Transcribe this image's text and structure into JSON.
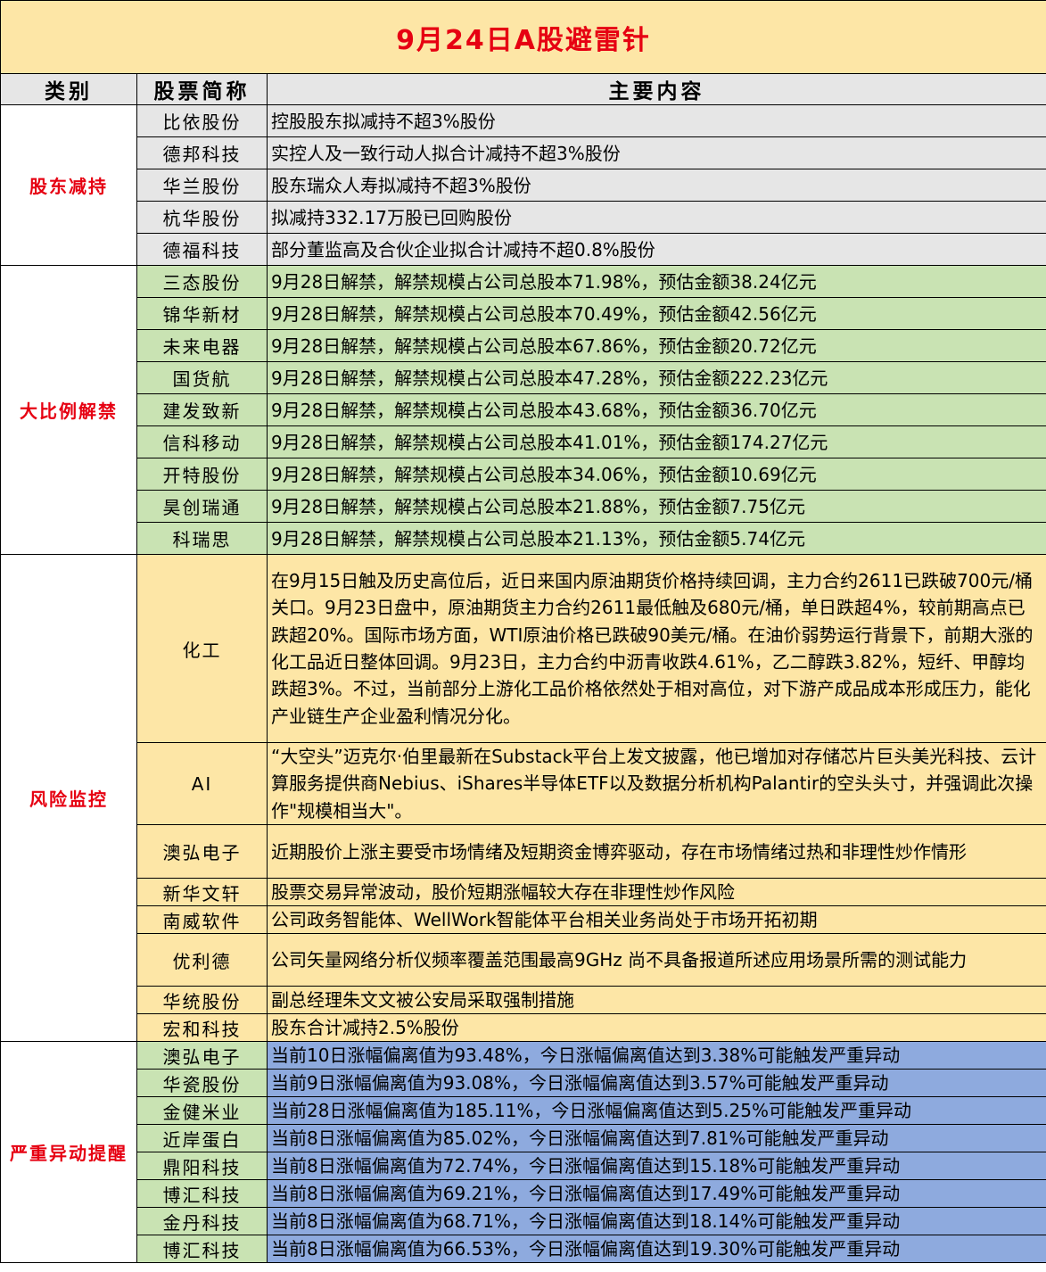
{
  "title": "9月24日A股避雷针",
  "headers": {
    "category": "类别",
    "stock": "股票简称",
    "content": "主要内容"
  },
  "sections": [
    {
      "category": "股东减持",
      "rows": [
        {
          "name": "比依股份",
          "content": "控股股东拟减持不超3%股份"
        },
        {
          "name": "德邦科技",
          "content": "实控人及一致行动人拟合计减持不超3%股份"
        },
        {
          "name": "华兰股份",
          "content": "股东瑞众人寿拟减持不超3%股份"
        },
        {
          "name": "杭华股份",
          "content": "拟减持332.17万股已回购股份"
        },
        {
          "name": "德福科技",
          "content": "部分董监高及合伙企业拟合计减持不超0.8%股份"
        }
      ]
    },
    {
      "category": "大比例解禁",
      "rows": [
        {
          "name": "三态股份",
          "content": "9月28日解禁，解禁规模占公司总股本71.98%，预估金额38.24亿元"
        },
        {
          "name": "锦华新材",
          "content": "9月28日解禁，解禁规模占公司总股本70.49%，预估金额42.56亿元"
        },
        {
          "name": "未来电器",
          "content": "9月28日解禁，解禁规模占公司总股本67.86%，预估金额20.72亿元"
        },
        {
          "name": "国货航",
          "content": "9月28日解禁，解禁规模占公司总股本47.28%，预估金额222.23亿元"
        },
        {
          "name": "建发致新",
          "content": "9月28日解禁，解禁规模占公司总股本43.68%，预估金额36.70亿元"
        },
        {
          "name": "信科移动",
          "content": "9月28日解禁，解禁规模占公司总股本41.01%，预估金额174.27亿元"
        },
        {
          "name": "开特股份",
          "content": "9月28日解禁，解禁规模占公司总股本34.06%，预估金额10.69亿元"
        },
        {
          "name": "昊创瑞通",
          "content": "9月28日解禁，解禁规模占公司总股本21.88%，预估金额7.75亿元"
        },
        {
          "name": "科瑞思",
          "content": "9月28日解禁，解禁规模占公司总股本21.13%，预估金额5.74亿元"
        }
      ]
    },
    {
      "category": "风险监控",
      "rows": [
        {
          "name": "化工",
          "content": "在9月15日触及历史高位后，近日来国内原油期货价格持续回调，主力合约2611已跌破700元/桶关口。9月23日盘中，原油期货主力合约2611最低触及680元/桶，单日跌超4%，较前期高点已跌超20%。国际市场方面，WTI原油价格已跌破90美元/桶。在油价弱势运行背景下，前期大涨的化工品近日整体回调。9月23日，主力合约中沥青收跌4.61%，乙二醇跌3.82%，短纤、甲醇均跌超3%。不过，当前部分上游化工品价格依然处于相对高位，对下游产成品成本形成压力，能化产业链生产企业盈利情况分化。"
        },
        {
          "name": "AI",
          "content": "“大空头”迈克尔·伯里最新在Substack平台上发文披露，他已增加对存储芯片巨头美光科技、云计算服务提供商Nebius、iShares半导体ETF以及数据分析机构Palantir的空头头寸，并强调此次操作\"规模相当大\"。"
        },
        {
          "name": "澳弘电子",
          "content": "近期股价上涨主要受市场情绪及短期资金博弈驱动，存在市场情绪过热和非理性炒作情形"
        },
        {
          "name": "新华文轩",
          "content": "股票交易异常波动，股价短期涨幅较大存在非理性炒作风险"
        },
        {
          "name": "南威软件",
          "content": "公司政务智能体、WellWork智能体平台相关业务尚处于市场开拓初期"
        },
        {
          "name": "优利德",
          "content": "公司矢量网络分析仪频率覆盖范围最高9GHz 尚不具备报道所述应用场景所需的测试能力"
        },
        {
          "name": "华统股份",
          "content": "副总经理朱文文被公安局采取强制措施"
        },
        {
          "name": "宏和科技",
          "content": "股东合计减持2.5%股份"
        }
      ]
    },
    {
      "category": "严重异动提醒",
      "rows": [
        {
          "name": "澳弘电子",
          "content": "当前10日涨幅偏离值为93.48%，今日涨幅偏离值达到3.38%可能触发严重异动"
        },
        {
          "name": "华瓷股份",
          "content": "当前9日涨幅偏离值为93.08%，今日涨幅偏离值达到3.57%可能触发严重异动"
        },
        {
          "name": "金健米业",
          "content": "当前28日涨幅偏离值为185.11%，今日涨幅偏离值达到5.25%可能触发严重异动"
        },
        {
          "name": "近岸蛋白",
          "content": "当前8日涨幅偏离值为85.02%，今日涨幅偏离值达到7.81%可能触发严重异动"
        },
        {
          "name": "鼎阳科技",
          "content": "当前8日涨幅偏离值为72.74%，今日涨幅偏离值达到15.18%可能触发严重异动"
        },
        {
          "name": "博汇科技",
          "content": "当前8日涨幅偏离值为69.21%，今日涨幅偏离值达到17.49%可能触发严重异动"
        },
        {
          "name": "金丹科技",
          "content": "当前8日涨幅偏离值为68.71%，今日涨幅偏离值达到18.14%可能触发严重异动"
        },
        {
          "name": "博汇科技",
          "content": "当前8日涨幅偏离值为66.53%，今日涨幅偏离值达到19.30%可能触发严重异动"
        }
      ]
    }
  ],
  "colors": {
    "title_bg": "#fde6a6",
    "title_text": "#e60012",
    "header_bg": "#e6e6e6",
    "reduce_bg": "#e6e6e6",
    "unlock_bg": "#c9e3b3",
    "risk_bg": "#fde6a6",
    "abnormal_bg": "#8eaade",
    "category_text": "#e60012"
  }
}
